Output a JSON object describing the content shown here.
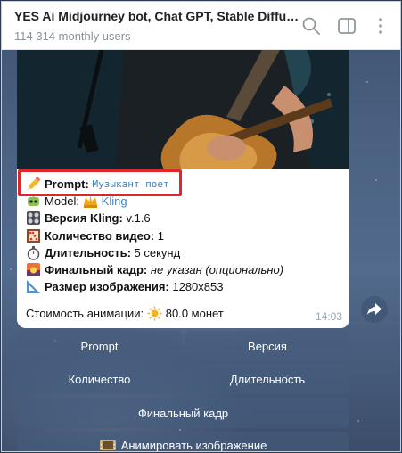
{
  "header": {
    "title": "YES Ai Midjourney bot, Chat GPT, Stable Diffusio...",
    "subtitle": "114 314 monthly users",
    "icons": [
      "search-icon",
      "sidebar-toggle-icon",
      "more-vertical-icon"
    ]
  },
  "message": {
    "prompt_label": "Prompt:",
    "prompt_value": "Музыкант поет",
    "model_label": "Model:",
    "model_value": "Kling",
    "version_label": "Версия Kling:",
    "version_value": "v.1.6",
    "count_label": "Количество видео:",
    "count_value": "1",
    "duration_label": "Длительность:",
    "duration_value": "5 секунд",
    "final_frame_label": "Финальный кадр:",
    "final_frame_value": "не указан (опционально)",
    "size_label": "Размер изображения:",
    "size_value": "1280x853",
    "cost_label": "Стоимость анимации:",
    "cost_value": "80.0 монет",
    "time": "14:03"
  },
  "keyboard": {
    "prompt": "Prompt",
    "version": "Версия",
    "count": "Количество",
    "duration": "Длительность",
    "final_frame": "Финальный кадр",
    "animate": "Анимировать изображение"
  },
  "colors": {
    "highlight": "#e0262b",
    "link": "#3a8ad3",
    "keyboard_button": "#465c7d"
  }
}
